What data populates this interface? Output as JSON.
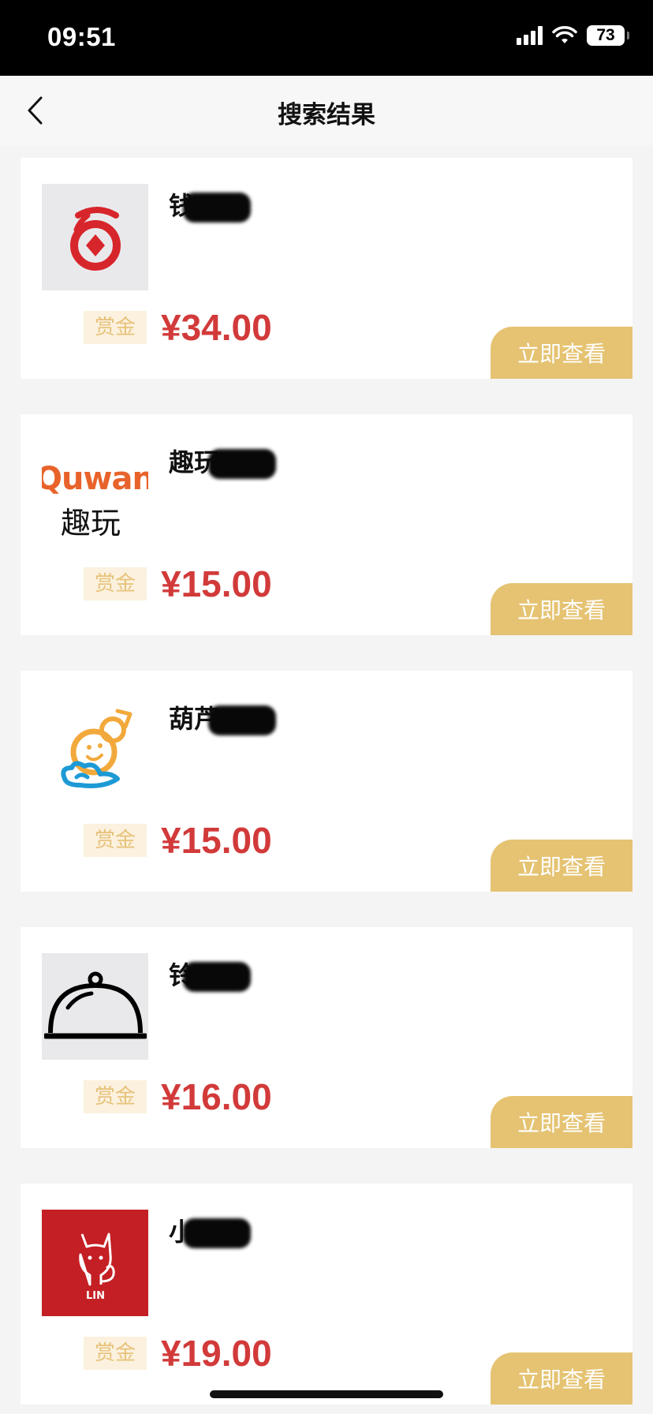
{
  "status_bar": {
    "time": "09:51",
    "battery": "73"
  },
  "nav": {
    "title": "搜索结果"
  },
  "results": [
    {
      "name": "钱",
      "reward_label": "赏金",
      "reward": "¥34.00",
      "button": "立即查看",
      "logo": "red-coin-logo"
    },
    {
      "name": "趣玩",
      "reward_label": "赏金",
      "reward": "¥15.00",
      "button": "立即查看",
      "logo": "quwan-logo",
      "logo_text_latin": "Quwan",
      "logo_text_cn": "趣玩"
    },
    {
      "name": "葫芦",
      "reward_label": "赏金",
      "reward": "¥15.00",
      "button": "立即查看",
      "logo": "gourd-mascot-logo"
    },
    {
      "name": "铃",
      "reward_label": "赏金",
      "reward": "¥16.00",
      "button": "立即查看",
      "logo": "cloche-logo"
    },
    {
      "name": "小",
      "reward_label": "赏金",
      "reward": "¥19.00",
      "button": "立即查看",
      "logo": "cat-lin-logo",
      "logo_text": "LIN"
    }
  ],
  "colors": {
    "accent": "#e5c372",
    "price": "#d23a3a",
    "tag_bg": "#fbf1de",
    "tag_text": "#e7c27a"
  }
}
